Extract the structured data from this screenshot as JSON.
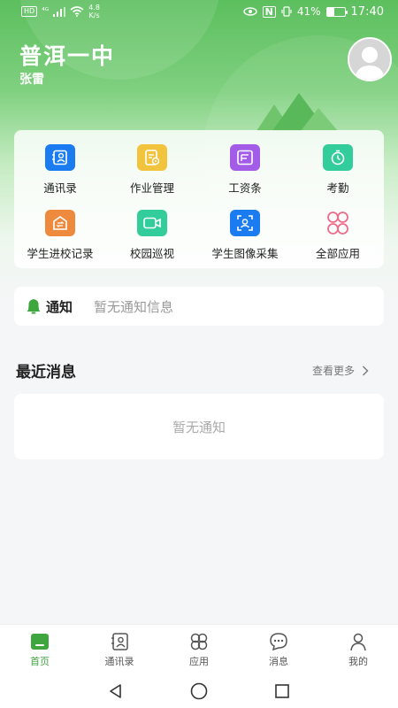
{
  "status_bar": {
    "hd": "HD",
    "signal_label": "⁴ᴳ",
    "net_speed_value": "4.8",
    "net_speed_unit": "K/s",
    "battery_percent": "41%",
    "battery_level": 0.41,
    "time": "17:40"
  },
  "header": {
    "school_name": "普洱一中",
    "user_name": "张雷"
  },
  "apps": [
    {
      "label": "通讯录",
      "icon": "contacts-icon",
      "color": "#1a7cf0"
    },
    {
      "label": "作业管理",
      "icon": "homework-icon",
      "color": "#f2c33d"
    },
    {
      "label": "工资条",
      "icon": "salary-icon",
      "color": "#a35ce8"
    },
    {
      "label": "考勤",
      "icon": "attendance-icon",
      "color": "#33cc9b"
    },
    {
      "label": "学生进校记录",
      "icon": "entry-record-icon",
      "color": "#ee8a3e"
    },
    {
      "label": "校园巡视",
      "icon": "camera-icon",
      "color": "#33cc9b"
    },
    {
      "label": "学生图像采集",
      "icon": "face-scan-icon",
      "color": "#1a7cf0"
    },
    {
      "label": "全部应用",
      "icon": "all-apps-icon",
      "color": "#f06b8a"
    }
  ],
  "notice": {
    "title": "通知",
    "text": "暂无通知信息"
  },
  "recent": {
    "title": "最近消息",
    "more": "查看更多",
    "empty": "暂无通知"
  },
  "tabs": [
    {
      "label": "首页",
      "icon": "home-icon",
      "active": true
    },
    {
      "label": "通讯录",
      "icon": "contacts-icon"
    },
    {
      "label": "应用",
      "icon": "apps-icon"
    },
    {
      "label": "消息",
      "icon": "message-icon"
    },
    {
      "label": "我的",
      "icon": "profile-icon"
    }
  ],
  "colors": {
    "brand": "#3fa63f",
    "header_green": "#5cbf5e"
  }
}
